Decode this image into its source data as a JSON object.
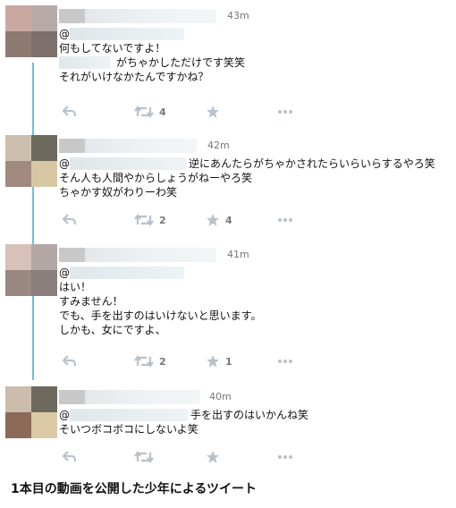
{
  "tweets": [
    {
      "time": "43m",
      "mention": "@",
      "lines": [
        "何もしてないですよ！",
        "がちゃかしただけです笑笑",
        "それがいけなかたんですかね？"
      ],
      "retweets": "4",
      "likes": "",
      "avatar_colors": [
        "#c8a9a0",
        "#b7aaa6",
        "#8f7a72",
        "#7d6f6c"
      ]
    },
    {
      "time": "42m",
      "mention": "@",
      "lines": [
        "逆にあんたらがちゃかされたらいらいらするやろ笑",
        "そん人も人間やからしょうがねーやろ笑",
        "ちゃかす奴がわりーわ笑"
      ],
      "retweets": "2",
      "likes": "4",
      "avatar_colors": [
        "#cdbfae",
        "#6c6a5c",
        "#a08a7d",
        "#d8c7a5"
      ]
    },
    {
      "time": "41m",
      "mention": "@",
      "lines": [
        "はい！",
        "すみません！",
        "でも、手を出すのはいけないと思います。",
        "しかも、女にですよ、"
      ],
      "retweets": "2",
      "likes": "1",
      "avatar_colors": [
        "#d7c1b8",
        "#b3a7a5",
        "#9a8780",
        "#8a7e7c"
      ]
    },
    {
      "time": "40m",
      "mention": "@",
      "lines": [
        "手を出すのはいかんね笑",
        "そいつボコボコにしないよ笑"
      ],
      "retweets": "",
      "likes": "",
      "avatar_colors": [
        "#cbbcab",
        "#6d6a5d",
        "#8b6a5a",
        "#dccaa6"
      ]
    }
  ],
  "caption": "1本目の動画を公開した少年によるツイート",
  "colors": {
    "thread_line": "#6cbde6",
    "icon": "#b8c2cc"
  }
}
